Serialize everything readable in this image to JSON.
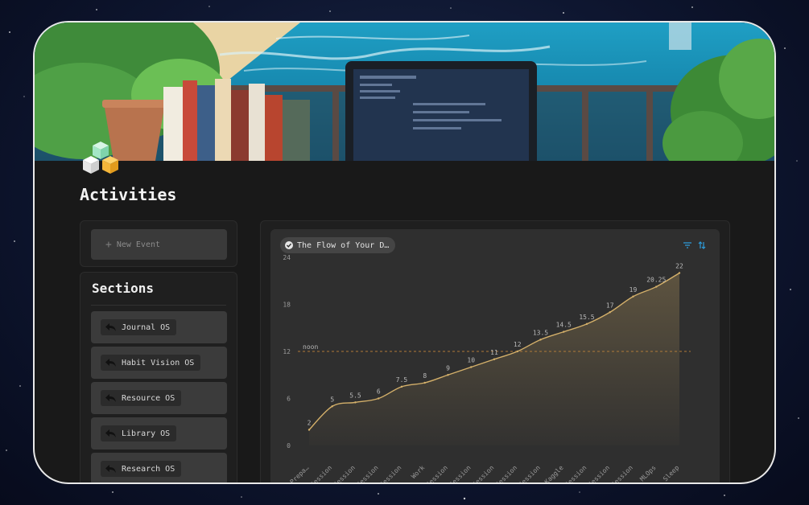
{
  "page": {
    "title": "Activities"
  },
  "new_event": {
    "label": "New Event"
  },
  "sections": {
    "title": "Sections",
    "items": [
      {
        "label": "Journal OS"
      },
      {
        "label": "Habit Vision OS"
      },
      {
        "label": "Resource OS"
      },
      {
        "label": "Library OS"
      },
      {
        "label": "Research OS"
      }
    ]
  },
  "chart_view": {
    "tab_label": "The Flow of Your D…",
    "filter_icon": "filter-icon",
    "sort_icon": "sort-icon"
  },
  "colors": {
    "accent": "#2d9cdb",
    "line": "#d4b06a",
    "reference": "#b07a3a",
    "panel": "#2f2f2f"
  },
  "chart_data": {
    "type": "area",
    "ylim": [
      0,
      24
    ],
    "yticks": [
      0,
      6,
      12,
      18,
      24
    ],
    "categories": [
      "Prepa…",
      "Session",
      "Session",
      "Session",
      "Session",
      "Work",
      "Session",
      "Session",
      "Session",
      "Session",
      "Session",
      "Kaggle",
      "Session",
      "Session",
      "Session",
      "MLOps",
      "Sleep"
    ],
    "values": [
      2,
      5,
      5.5,
      6,
      7.5,
      8,
      9,
      10,
      11,
      12,
      13.5,
      14.5,
      15.5,
      17,
      19,
      20.25,
      22
    ],
    "value_labels": [
      "2",
      "5",
      "5.5",
      "6",
      "7.5",
      "8",
      "9",
      "10",
      "11",
      "12",
      "13.5",
      "14.5",
      "15.5",
      "17",
      "19",
      "20.25",
      "22"
    ],
    "reference_line": {
      "value": 12,
      "label": "noon"
    },
    "grid": false,
    "legend": "none"
  }
}
